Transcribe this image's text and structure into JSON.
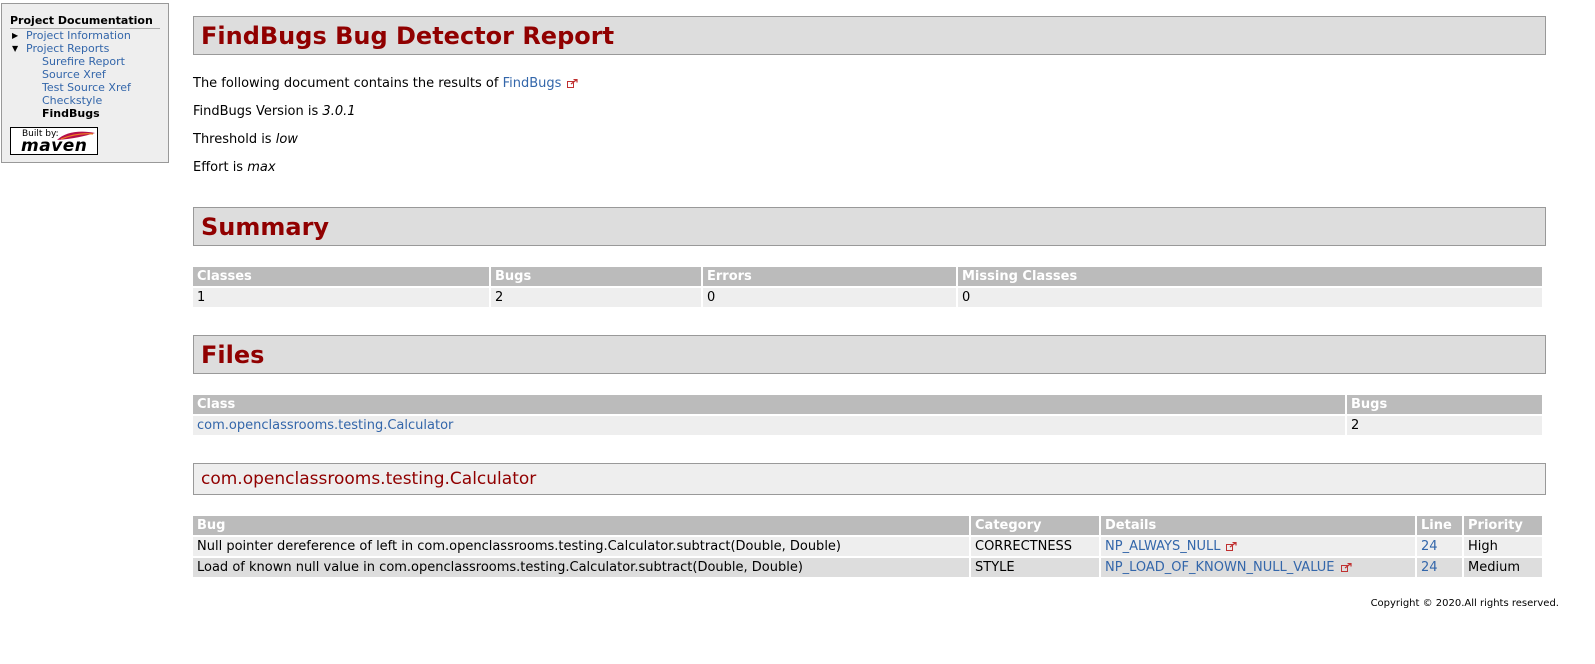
{
  "nav": {
    "heading": "Project Documentation",
    "items": [
      {
        "label": "Project Information",
        "expanded": false
      },
      {
        "label": "Project Reports",
        "expanded": true
      }
    ],
    "subitems": [
      {
        "label": "Surefire Report"
      },
      {
        "label": "Source Xref"
      },
      {
        "label": "Test Source Xref"
      },
      {
        "label": "Checkstyle"
      },
      {
        "label": "FindBugs",
        "selected": true
      }
    ],
    "built_by": "Built by:",
    "maven_logo_text": "maven"
  },
  "report": {
    "title": "FindBugs Bug Detector Report",
    "intro_prefix": "The following document contains the results of",
    "intro_link": "FindBugs",
    "version_prefix": "FindBugs Version is",
    "version": "3.0.1",
    "threshold_prefix": "Threshold is",
    "threshold": "low",
    "effort_prefix": "Effort is",
    "effort": "max"
  },
  "summary": {
    "title": "Summary",
    "headers": [
      "Classes",
      "Bugs",
      "Errors",
      "Missing Classes"
    ],
    "row": [
      "1",
      "2",
      "0",
      "0"
    ]
  },
  "files": {
    "title": "Files",
    "headers": [
      "Class",
      "Bugs"
    ],
    "rows": [
      {
        "class": "com.openclassrooms.testing.Calculator",
        "bugs": "2"
      }
    ]
  },
  "class_detail": {
    "title": "com.openclassrooms.testing.Calculator",
    "headers": [
      "Bug",
      "Category",
      "Details",
      "Line",
      "Priority"
    ],
    "rows": [
      {
        "bug": "Null pointer dereference of left in com.openclassrooms.testing.Calculator.subtract(Double, Double)",
        "category": "CORRECTNESS",
        "details": "NP_ALWAYS_NULL",
        "line": "24",
        "priority": "High"
      },
      {
        "bug": "Load of known null value in com.openclassrooms.testing.Calculator.subtract(Double, Double)",
        "category": "STYLE",
        "details": "NP_LOAD_OF_KNOWN_NULL_VALUE",
        "line": "24",
        "priority": "Medium"
      }
    ]
  },
  "footer": {
    "copyright": "Copyright © 2020.All rights reserved."
  },
  "colors": {
    "heading_red": "#900000",
    "link_blue": "#3366aa",
    "table_header_bg": "#bbbbbb",
    "section_bg": "#dddddd"
  }
}
